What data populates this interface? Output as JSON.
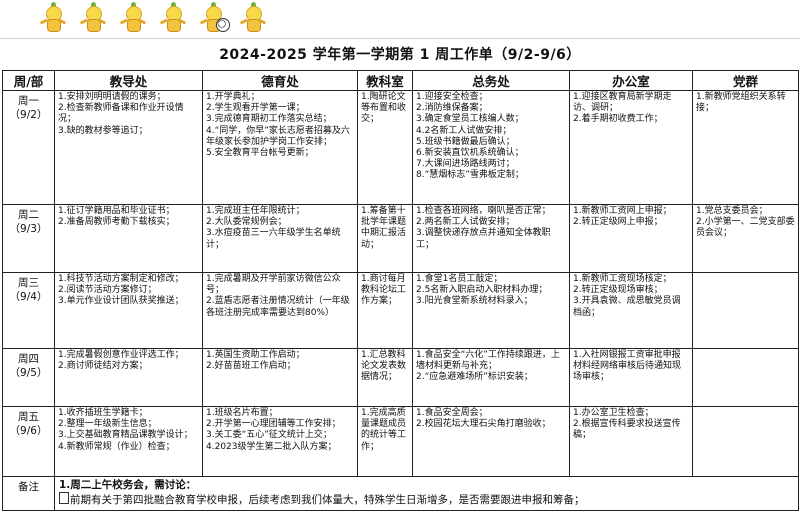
{
  "title": "2024-2025 学年第一学期第 1 周工作单（9/2-9/6）",
  "headers": [
    "周/部",
    "教导处",
    "德育处",
    "教科室",
    "总务处",
    "办公室",
    "党群"
  ],
  "rows": [
    {
      "day": "周一",
      "date": "（9/2）",
      "jiaodao": [
        "1.安排刘明明请假的课务；",
        "2.检查新教师备课和作业开设情况；",
        "3.缺的教材参等追订；"
      ],
      "deyu": [
        "1.开学典礼；",
        "2.学生观看开学第一课；",
        "3.完成德育期初工作落实总结；",
        "4.“同学，你早”家长志愿者招募及六年级家长参加护学岗工作安排；",
        "5.安全教育平台帐号更新；"
      ],
      "jiaoke": [
        "1.陶研论文等布置和收交；"
      ],
      "zongwu": [
        "1.迎接安全检查；",
        "2.消防维保备案；",
        "3.确定食堂员工核编人数；",
        "4.2名新工人试做安排；",
        "5.班级书籍做最后确认；",
        "6.新安装直饮机系统确认；",
        "7.大课间进场路线两讨；",
        "8.“慧烟标志”雪弗板定制；"
      ],
      "bangong": [
        "1.迎接区教育局新学期走访、调研；",
        "2.着手期初收费工作；"
      ],
      "dangqun": [
        "1.新教师党组织关系转接；"
      ]
    },
    {
      "day": "周二",
      "date": "（9/3）",
      "jiaodao": [
        "1.征订学籍用品和毕业证书；",
        "2.准备周教师考勤下载核实；"
      ],
      "deyu": [
        "1.完成班主任年限统计；",
        "2.大队委常规例会；",
        "3.水痘疫苗三一六年级学生名单统计；"
      ],
      "jiaoke": [
        "1.筹备第十批学年课题中期汇报活动；"
      ],
      "zongwu": [
        "1.检查各班网络，喇叭是否正常；",
        "2.两名新工人试做安排；",
        "3.调整快递存放点并通知全体教职工；"
      ],
      "bangong": [
        "1.新教师工资网上申报；",
        "2.转正定级网上申报；"
      ],
      "dangqun": [
        "1.党总支委员会；",
        "2.小学第一、二党支部委员会议；"
      ]
    },
    {
      "day": "周三",
      "date": "（9/4）",
      "jiaodao": [
        "1.科技节活动方案制定和修改；",
        "2.阅读节活动方案修订；",
        "3.单元作业设计团队获奖推送；"
      ],
      "deyu": [
        "1.完成暑期及开学前家访微信公众号；",
        "2.蓝盾志愿者注册情况统计（一年级各班注册完成率需要达到80%）"
      ],
      "jiaoke": [
        "1.商讨每月教科论坛工作方案；"
      ],
      "zongwu": [
        "1.食堂1名员工敲定；",
        "2.5名新入职启动入职材料办理；",
        "3.阳光食堂新系统材料录入；"
      ],
      "bangong": [
        "1.新教师工资现场核定；",
        "2.转正定级现场审核；",
        "3.开具袁微、成思敏党员调档函；"
      ],
      "dangqun": []
    },
    {
      "day": "周四",
      "date": "（9/5）",
      "jiaodao": [
        "1.完成暑假创意作业评选工作；",
        "2.商讨师徒结对方案；"
      ],
      "deyu": [
        "1.英国生资助工作启动；",
        "2.好苗苗班工作启动；"
      ],
      "jiaoke": [
        "1.汇总教科论文发表数据情况；"
      ],
      "zongwu": [
        "1.食品安全“六化”工作持续跟进，上墙材料更新与补充；",
        "2.“应急避难场所”标识安装；"
      ],
      "bangong": [
        "1.入社网银报工资审批申报材料经网络审核后待通知现场审核；"
      ],
      "dangqun": []
    },
    {
      "day": "周五",
      "date": "（9/6）",
      "jiaodao": [
        "1.收齐插班生学籍卡；",
        "2.整理一年级新生信息；",
        "3.上交基础教育精品课教学设计；",
        "4.新教师常规（作业）检查；"
      ],
      "deyu": [
        "1.班级名片布置；",
        "2.开学第一心理团辅等工作安排；",
        "3.关工委“五心”征文统计上交；",
        "4.2023级学生第二批入队方案；"
      ],
      "jiaoke": [
        "1.完成高质量课题成员的统计等工作；"
      ],
      "zongwu": [
        "1.食品安全周会；",
        "2.校园花坛大理石尖角打磨验收；"
      ],
      "bangong": [
        "1.办公室卫生检查；",
        "2.根据宣传科要求投送宣传稿；"
      ],
      "dangqun": []
    }
  ],
  "notes": {
    "label": "备注",
    "heading": "1.周二上午校务会，需讨论：",
    "line": "前期有关于第四批融合教育学校申报，后续考虑到我们体量大，特殊学生日渐增多，是否需要跟进申报和筹备；"
  }
}
